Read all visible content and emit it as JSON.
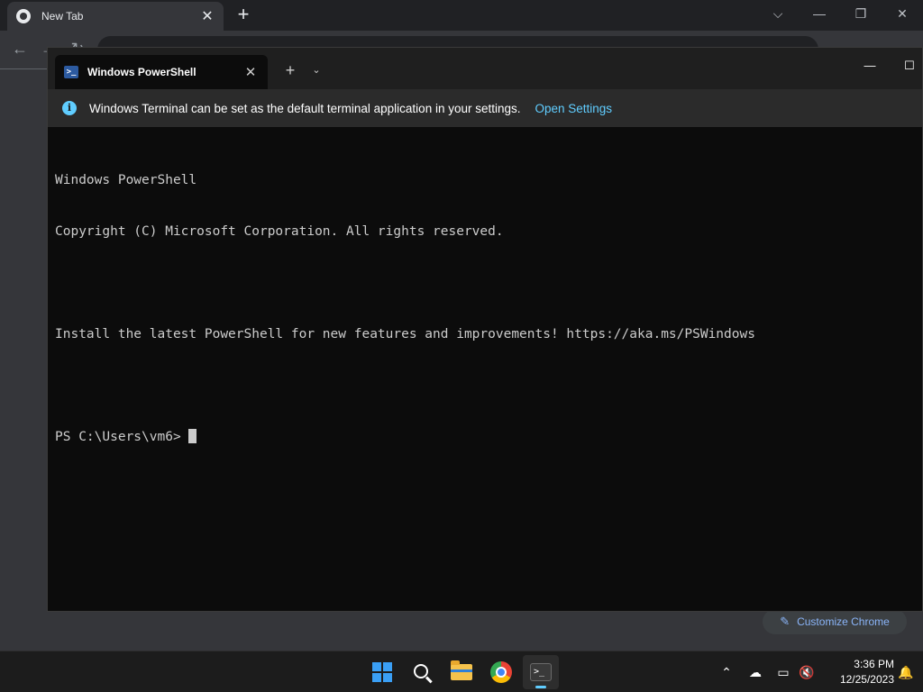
{
  "chrome": {
    "tab": {
      "title": "New Tab",
      "favicon": "chrome-icon",
      "close_glyph": "✕"
    },
    "new_tab_glyph": "+",
    "window_controls": {
      "tab_search": "⌵",
      "minimize": "—",
      "restore": "❐",
      "close": "✕"
    },
    "nav": {
      "back": "←",
      "forward": "→",
      "reload": "↻"
    },
    "customize": {
      "icon": "pencil-icon",
      "label": "Customize Chrome"
    }
  },
  "terminal": {
    "tab": {
      "title": "Windows PowerShell",
      "icon": "powershell-icon",
      "icon_glyph": ">_",
      "close_glyph": "✕"
    },
    "new_tab_glyph": "+",
    "dropdown_glyph": "⌄",
    "window_controls": {
      "minimize": "—",
      "maximize": "☐"
    },
    "banner": {
      "icon": "info-icon",
      "icon_glyph": "i",
      "message": "Windows Terminal can be set as the default terminal application in your settings.",
      "link": "Open Settings"
    },
    "output": {
      "line1": "Windows PowerShell",
      "line2": "Copyright (C) Microsoft Corporation. All rights reserved.",
      "line3": "",
      "line4": "Install the latest PowerShell for new features and improvements! https://aka.ms/PSWindows",
      "line5": "",
      "prompt": "PS C:\\Users\\vm6> "
    }
  },
  "taskbar": {
    "apps": [
      "start-icon",
      "search-icon",
      "file-explorer-icon",
      "chrome-icon",
      "terminal-icon"
    ],
    "terminal_glyph": ">_",
    "tray": {
      "chevron": "⌃",
      "onedrive": "☁",
      "display": "▭",
      "volume": "🔇",
      "notifications": "🔔"
    },
    "clock": {
      "time": "3:36 PM",
      "date": "12/25/2023"
    },
    "accent_color": "#60cdff"
  }
}
